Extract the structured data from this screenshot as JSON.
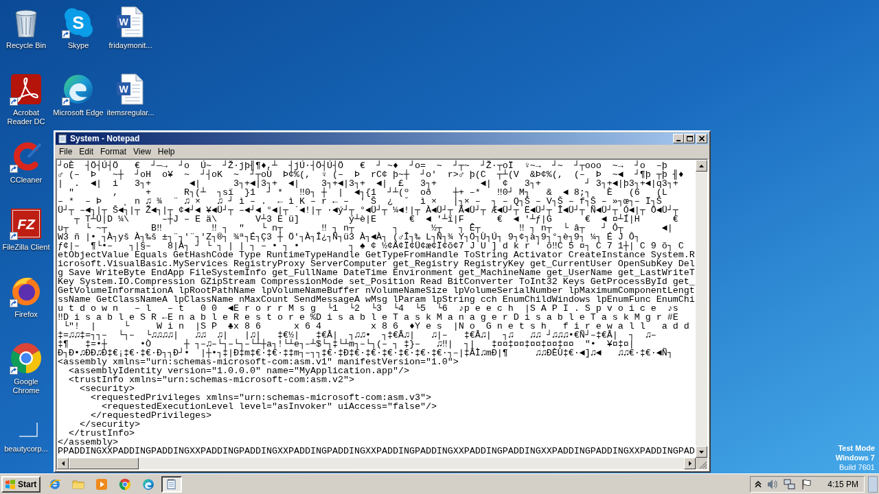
{
  "desktop": {
    "icons": [
      {
        "label": "Recycle Bin",
        "kind": "recycle-bin",
        "shortcut": false
      },
      {
        "label": "Skype",
        "kind": "skype",
        "glyph": "S",
        "shortcut": true
      },
      {
        "label": "fridaymonit...",
        "kind": "word-doc",
        "glyph": "W",
        "shortcut": false
      },
      {
        "label": "Acrobat Reader DC",
        "kind": "acrobat",
        "shortcut": true
      },
      {
        "label": "Microsoft Edge",
        "kind": "edge",
        "shortcut": true
      },
      {
        "label": "itemsregular...",
        "kind": "word-doc",
        "glyph": "W",
        "shortcut": false
      },
      {
        "label": "CCleaner",
        "kind": "ccleaner",
        "shortcut": true
      },
      {
        "label": "FileZilla Client",
        "kind": "filezilla",
        "glyph": "FZ",
        "shortcut": true
      },
      {
        "label": "Firefox",
        "kind": "firefox",
        "shortcut": true
      },
      {
        "label": "Google Chrome",
        "kind": "chrome",
        "shortcut": true
      },
      {
        "label": "beautycorp...",
        "kind": "blank-doc",
        "shortcut": false
      }
    ]
  },
  "window": {
    "title": "System - Notepad",
    "menu": [
      "File",
      "Edit",
      "Format",
      "View",
      "Help"
    ],
    "lines": [
      "┘oÈ  ┤Ö┤Ú┤Ö   €  ┘—→  ┘o  Ú~  ┘Ž·jþ╢¶♦,┴  ┤jÚ·┤Ö┤Ú┤Ö   €  ┘ ~♦  ┘o=  ~  ┘┬~  ┘Ž·┬oÏ  ♀~→  ┘~  ┘┬ooo  ~→  ┘o  –þ",
      "♂ (–  Þ   ~┼  ┘oH  o¥  ~  ┘┤oK  ~  ┘┬oÙ  Þ¢%(,  ♀ (–  Þ  rC¢ þ~┼  ┘o'  r>♂ þ(C  ┬┴(V  &Þ¢%(,  (–  Þ  ~◄  ┘¶þ ┬þ ╢♦",
      "|  .  ◄|  i   3┐+       ◄|      3┐+◄|3┐+  ◄|    3┐+◄|3┐+  ◄|  £   3┐+        ◄|  ¢   3┐+        ┘ 3┐+◄|þ3┐+◄|q3┐+",
      "  \"       ,     +      R┐(┴  ┐sï  }1  ┘ *   ‼0┐ ┼  |  ◄┐{1  ┘┴(º  oð    ┼+ –*   ‼0┘ M┐   &  ◄ 8;┐   È   (6   (L",
      "– *  – Þ    ¸ n ♫ ¾  ¨ ♫ ×   ♫ ┘ ì – .  ← ì K – r ← –  ' Š  ¿  ˘  ì ×   |┐× –  ┐ – Q┐Š – V┐Š – f┐Š – »┐œ┐– Ï┐Š",
      "Ü┘┬ –◄┐|┬ Š◄┐|┬ Ž◄┐|┬ ¢◄┘◄ ¥◄Ü┘┬ –◄┘◄ °◄|┬ ´◄!|┬ ·◄ý┘┬ °◄Ü┘┬ ¼◄!|┬ À◄Ü┘┬ Ã◄Ü┘┬ Æ◄Ü┘┬ Ë◄Ü┘┬ Î◄Ü┘┬ Ñ◄Ü┘┬ Ó◄|┬ Ö◄Ü┘┬",
      "   ┬ T┴Ü|D ¼\\      –┼J – E ä\\       V┴3 E ü]         ý┴è|E      €  ◄ '┴ï|F      €  ◄ '┴ƒ|G      €  ◄ ¤┴Í|H      €",
      "u┬   └ ~┬        B‼         ‼ ┐  \"   └ n┬       ‼ ┐ n┬       ┐      ½┬   ┐ Ê┬       ‼ ┐ n┬  └ â┬   ┘ Ô┬       ◄|",
      "W3 ñ |• ┐À┐yš À┐‰š ±┐¨┐'¨┐'Z┐®┐ ¾ª┐É┐Ç3 ┼ Ö'┐À┐Î¿┐Ñ┐ü3 À┐◄À┐ (♂Î┐‰ L┐Ñ┐¾ Y┐Ö┐Ù┐Ú┐ 9┐¢┐à┐9┐°┐è┐9┐ ¼┐ É J Ô┐",
      "ƒ¢|–  ¶└•–   ┐|§–   8|À┐ ┘ └ ┐ | | ┐ – • ┐ •         ┐ ♠ ¢ ½¢Ä¢Ï¢Ü¢æ¢Ï¢õ¢7 J U ] d k r ' õ‼C 5 ¤┐ C 7 1┼| C 9 õ┐ C",
      "etObjectValue Equals GetHashCode Type RuntimeTypeHandle GetTypeFromHandle ToString Activator CreateInstance System.R",
      "icrosoft.VisualBasic.MyServices RegistryProxy ServerComputer get_Registry RegistryKey get_CurrentUser OpenSubKey Del",
      "g Save WriteByte EndApp FileSystemInfo get_FullName DateTime Environment get_MachineName get_UserName get_LastWriteT",
      "Key System.IO.Compression GZipStream CompressionMode set_Position Read BitConverter ToInt32 Keys GetProcessById get_",
      "GetVolumeInformationA lpRootPathName lpVolumeNameBuffer nVolumeNameSize lpVolumeSerialNumber lpMaximumComponentLengt",
      "ssName GetClassNameA lpClassName nMaxCount SendMessageA wMsg lParam lpString cch EnumChildWindows lpEnumFunc EnumChi",
      "u t d o w n   – l   – t   0 0  ◄E r o r r M s g  └1  └2  └3  └4  └5  └6  ♪p e e c h  |S A P I . S p v o i c e  ♪s",
      "‼D i s a b l e S R ←E n a b l e R e s t o r e %D i s a b l e T a s k M a n a g e r D i s a b l e T a s k M g r #E",
      " └\"!  |     └     W i n  |S P  ♣x 8 6      x 6 4         x 8 6  ♦Y e s  |N o  G n e t s h   f i r e w a l l   a d d",
      "‡=♫♫‡=┐┐–  └┐–  └♫♫♫♫|   ♫♫  ♫|   |♫|   ‡€½|   ‡€Â|  ┐♫♫•  ┐‡€Â♫|   ♫|–   ‡€Â♫|  ┐♫   ♫♫ ┘♫♫♫•€Ñ┘–‡€Â|  ┐  ♫–",
      "‡¶   ‡=•┼      •Ò      ┼ ┐–♫–└┐–└┐–└┴┼a┐!└┴e┐–┴$└┐‡└┴m┐–└┐(– ┐ ‡}–   ♫‼|  ┐|   ‡¤¤‡¤¤‡¤¤‡¤¤‡¤¤  \"•  ¥¤‡¤|",
      "Ð┐Ð•♫ÐÐ♫Ð‡€¡‡€·‡€·Ð┐┐Ð┘•  |┼•┐‡|Ð‡m‡€·‡€·‡‡m┐–┐┐‡€·‡Ð‡€·‡€·‡€·‡€·‡€·‡€·┐–|‡ÂÌ♫mÐ|¶     ♫♫ÐÈÙ‡€·◄]♫◄   ♫♫€·‡€·◄Ñ┐",
      "<assembly xmlns=\"urn:schemas-microsoft-com:asm.v1\" manifestVersion=\"1.0\">",
      "  <assemblyIdentity version=\"1.0.0.0\" name=\"MyApplication.app\"/>",
      "  <trustInfo xmlns=\"urn:schemas-microsoft-com:asm.v2\">",
      "    <security>",
      "      <requestedPrivileges xmlns=\"urn:schemas-microsoft-com:asm.v3\">",
      "        <requestedExecutionLevel level=\"asInvoker\" uiAccess=\"false\"/>",
      "      </requestedPrivileges>",
      "    </security>",
      "  </trustInfo>",
      "</assembly>",
      "PPADDINGXXPADDINGPADDINGXXPADDINGPADDINGXXPADDINGPADDINGXXPADDINGPADDINGXXPADDINGPADDINGXXPADDINGPADDINGXXPADDINGPAD"
    ]
  },
  "system_notice": [
    {
      "text": "Test Mode",
      "bold": true
    },
    {
      "text": "Windows 7",
      "bold": true
    },
    {
      "text": "Build 7601",
      "bold": false
    }
  ],
  "taskbar": {
    "start": "Start",
    "quick_launch": [
      {
        "kind": "ie"
      },
      {
        "kind": "folder"
      },
      {
        "kind": "media-player"
      },
      {
        "kind": "chrome"
      },
      {
        "kind": "edge"
      }
    ],
    "tasks": [
      {
        "kind": "notepad",
        "selected": true
      }
    ],
    "clock": "4:15 PM"
  }
}
